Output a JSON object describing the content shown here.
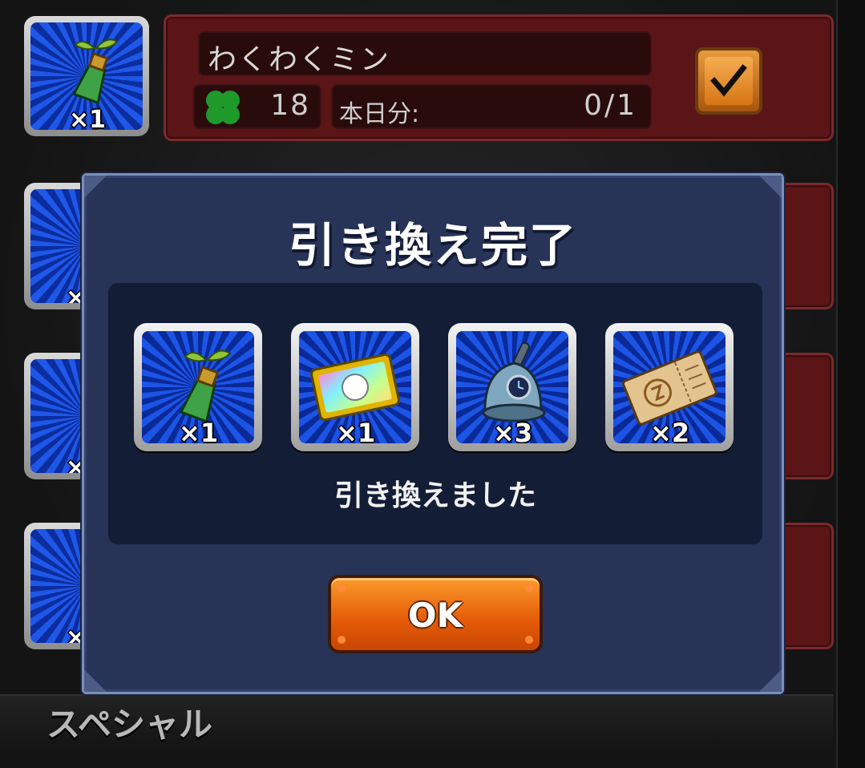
{
  "list_row": {
    "name": "わくわくミン",
    "clover_count": "18",
    "daily_label": "本日分:",
    "daily_value": "0/1",
    "item_qty": "×1",
    "checked": true
  },
  "hidden_rows_qty": [
    "×",
    "×",
    "×"
  ],
  "section": {
    "label": "スペシャル"
  },
  "dialog": {
    "title": "引き換え完了",
    "message": "引き換えました",
    "ok_label": "OK",
    "rewards": [
      {
        "icon": "bottle-sprout-icon",
        "qty": "×1"
      },
      {
        "icon": "rainbow-ticket-icon",
        "qty": "×1"
      },
      {
        "icon": "bell-clock-icon",
        "qty": "×3"
      },
      {
        "icon": "gold-ticket-icon",
        "qty": "×2"
      }
    ]
  },
  "colors": {
    "dialog_bg": "#283457",
    "ok_orange": "#e45a07",
    "row_red": "#5b1517",
    "clover_green": "#1f9a2a"
  }
}
